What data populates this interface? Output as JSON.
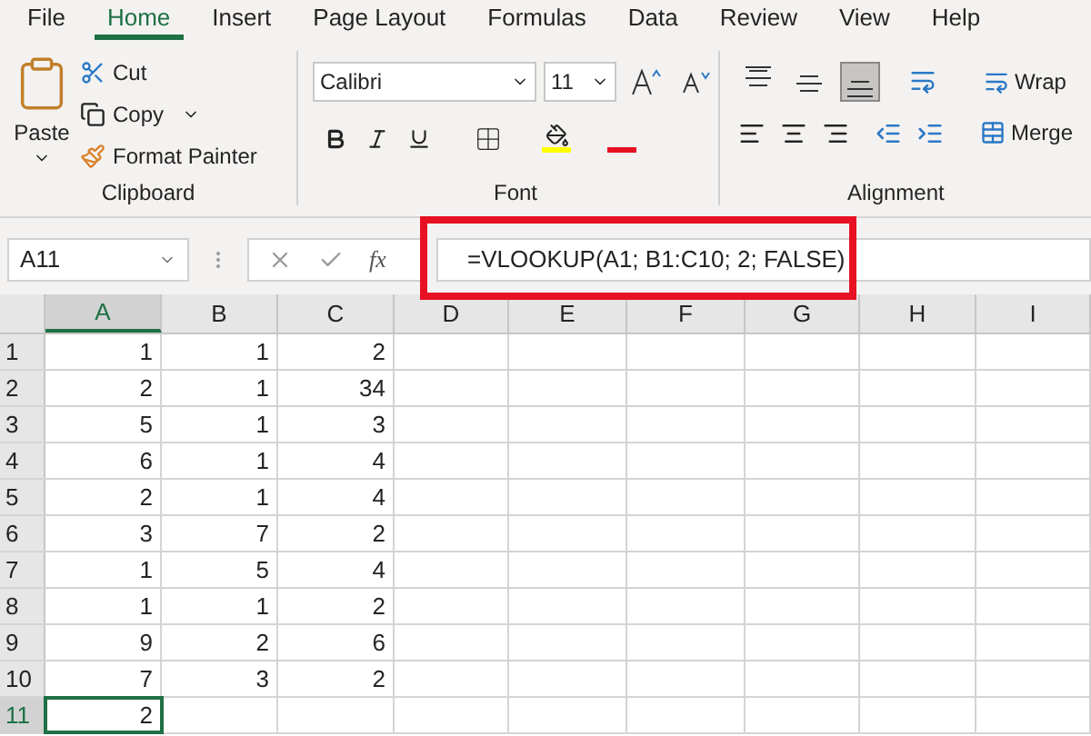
{
  "ribbon_tabs": [
    {
      "label": "File",
      "selected": false
    },
    {
      "label": "Home",
      "selected": true
    },
    {
      "label": "Insert",
      "selected": false
    },
    {
      "label": "Page Layout",
      "selected": false
    },
    {
      "label": "Formulas",
      "selected": false
    },
    {
      "label": "Data",
      "selected": false
    },
    {
      "label": "Review",
      "selected": false
    },
    {
      "label": "View",
      "selected": false
    },
    {
      "label": "Help",
      "selected": false
    }
  ],
  "clipboard": {
    "paste": "Paste",
    "cut": "Cut",
    "copy": "Copy",
    "format_painter": "Format Painter",
    "label": "Clipboard"
  },
  "font": {
    "name": "Calibri",
    "size": "11",
    "label": "Font"
  },
  "alignment": {
    "buttons": [
      {
        "kind": "top",
        "selected": false
      },
      {
        "kind": "middle",
        "selected": false
      },
      {
        "kind": "bottom",
        "selected": true
      }
    ],
    "wrap": "Wrap",
    "merge": "Merge",
    "label": "Alignment"
  },
  "formula_bar": {
    "name_box": "A11",
    "fx": "fx",
    "formula": "=VLOOKUP(A1; B1:C10; 2; FALSE)",
    "highlighted": true
  },
  "columns": [
    {
      "label": "A",
      "selected": true
    },
    {
      "label": "B",
      "selected": false
    },
    {
      "label": "C",
      "selected": false
    },
    {
      "label": "D",
      "selected": false
    },
    {
      "label": "E",
      "selected": false
    },
    {
      "label": "F",
      "selected": false
    },
    {
      "label": "G",
      "selected": false
    },
    {
      "label": "H",
      "selected": false
    },
    {
      "label": "I",
      "selected": false
    }
  ],
  "rows": [
    {
      "header": "1",
      "selected": false,
      "cells": [
        {
          "value": "1",
          "selected": false
        },
        {
          "value": "1",
          "selected": false
        },
        {
          "value": "2",
          "selected": false
        }
      ]
    },
    {
      "header": "2",
      "selected": false,
      "cells": [
        {
          "value": "2",
          "selected": false
        },
        {
          "value": "1",
          "selected": false
        },
        {
          "value": "34",
          "selected": false
        }
      ]
    },
    {
      "header": "3",
      "selected": false,
      "cells": [
        {
          "value": "5",
          "selected": false
        },
        {
          "value": "1",
          "selected": false
        },
        {
          "value": "3",
          "selected": false
        }
      ]
    },
    {
      "header": "4",
      "selected": false,
      "cells": [
        {
          "value": "6",
          "selected": false
        },
        {
          "value": "1",
          "selected": false
        },
        {
          "value": "4",
          "selected": false
        }
      ]
    },
    {
      "header": "5",
      "selected": false,
      "cells": [
        {
          "value": "2",
          "selected": false
        },
        {
          "value": "1",
          "selected": false
        },
        {
          "value": "4",
          "selected": false
        }
      ]
    },
    {
      "header": "6",
      "selected": false,
      "cells": [
        {
          "value": "3",
          "selected": false
        },
        {
          "value": "7",
          "selected": false
        },
        {
          "value": "2",
          "selected": false
        }
      ]
    },
    {
      "header": "7",
      "selected": false,
      "cells": [
        {
          "value": "1",
          "selected": false
        },
        {
          "value": "5",
          "selected": false
        },
        {
          "value": "4",
          "selected": false
        }
      ]
    },
    {
      "header": "8",
      "selected": false,
      "cells": [
        {
          "value": "1",
          "selected": false
        },
        {
          "value": "1",
          "selected": false
        },
        {
          "value": "2",
          "selected": false
        }
      ]
    },
    {
      "header": "9",
      "selected": false,
      "cells": [
        {
          "value": "9",
          "selected": false
        },
        {
          "value": "2",
          "selected": false
        },
        {
          "value": "6",
          "selected": false
        }
      ]
    },
    {
      "header": "10",
      "selected": false,
      "cells": [
        {
          "value": "7",
          "selected": false
        },
        {
          "value": "3",
          "selected": false
        },
        {
          "value": "2",
          "selected": false
        }
      ]
    },
    {
      "header": "11",
      "selected": true,
      "cells": [
        {
          "value": "2",
          "selected": true
        }
      ]
    }
  ]
}
